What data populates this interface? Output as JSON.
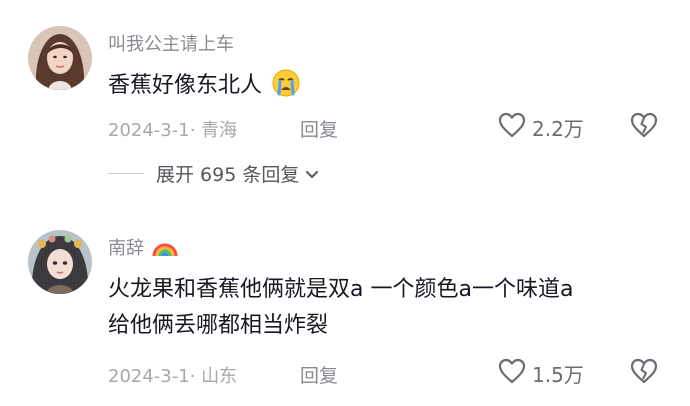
{
  "comments": [
    {
      "username": "叫我公主请上车",
      "text_line1": "香蕉好像东北人",
      "date_location": "2024-3-1· 青海",
      "reply_label": "回复",
      "likes": "2.2万",
      "expand_label": "展开 695 条回复"
    },
    {
      "username": "南辞",
      "text_line1": "火龙果和香蕉他俩就是双a  一个颜色a一个味道a",
      "text_line2": "给他俩丢哪都相当炸裂",
      "date_location": "2024-3-1· 山东",
      "reply_label": "回复",
      "likes": "1.5万"
    }
  ],
  "colors": {
    "text": "#161823",
    "meta": "#a7a8ad",
    "username": "#8a8b91"
  },
  "icons": [
    "avatar",
    "crying-emoji",
    "rainbow-icon",
    "heart-icon",
    "broken-heart-icon",
    "chevron-down-icon"
  ]
}
